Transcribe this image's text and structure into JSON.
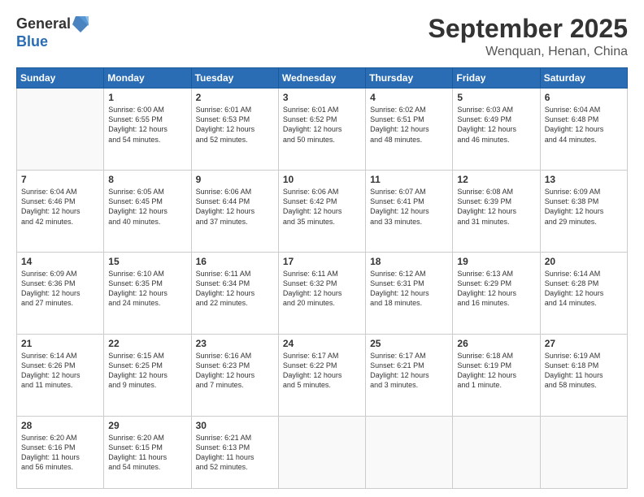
{
  "header": {
    "logo_general": "General",
    "logo_blue": "Blue",
    "title": "September 2025",
    "location": "Wenquan, Henan, China"
  },
  "days_of_week": [
    "Sunday",
    "Monday",
    "Tuesday",
    "Wednesday",
    "Thursday",
    "Friday",
    "Saturday"
  ],
  "weeks": [
    [
      {
        "day": "",
        "info": ""
      },
      {
        "day": "1",
        "info": "Sunrise: 6:00 AM\nSunset: 6:55 PM\nDaylight: 12 hours\nand 54 minutes."
      },
      {
        "day": "2",
        "info": "Sunrise: 6:01 AM\nSunset: 6:53 PM\nDaylight: 12 hours\nand 52 minutes."
      },
      {
        "day": "3",
        "info": "Sunrise: 6:01 AM\nSunset: 6:52 PM\nDaylight: 12 hours\nand 50 minutes."
      },
      {
        "day": "4",
        "info": "Sunrise: 6:02 AM\nSunset: 6:51 PM\nDaylight: 12 hours\nand 48 minutes."
      },
      {
        "day": "5",
        "info": "Sunrise: 6:03 AM\nSunset: 6:49 PM\nDaylight: 12 hours\nand 46 minutes."
      },
      {
        "day": "6",
        "info": "Sunrise: 6:04 AM\nSunset: 6:48 PM\nDaylight: 12 hours\nand 44 minutes."
      }
    ],
    [
      {
        "day": "7",
        "info": "Sunrise: 6:04 AM\nSunset: 6:46 PM\nDaylight: 12 hours\nand 42 minutes."
      },
      {
        "day": "8",
        "info": "Sunrise: 6:05 AM\nSunset: 6:45 PM\nDaylight: 12 hours\nand 40 minutes."
      },
      {
        "day": "9",
        "info": "Sunrise: 6:06 AM\nSunset: 6:44 PM\nDaylight: 12 hours\nand 37 minutes."
      },
      {
        "day": "10",
        "info": "Sunrise: 6:06 AM\nSunset: 6:42 PM\nDaylight: 12 hours\nand 35 minutes."
      },
      {
        "day": "11",
        "info": "Sunrise: 6:07 AM\nSunset: 6:41 PM\nDaylight: 12 hours\nand 33 minutes."
      },
      {
        "day": "12",
        "info": "Sunrise: 6:08 AM\nSunset: 6:39 PM\nDaylight: 12 hours\nand 31 minutes."
      },
      {
        "day": "13",
        "info": "Sunrise: 6:09 AM\nSunset: 6:38 PM\nDaylight: 12 hours\nand 29 minutes."
      }
    ],
    [
      {
        "day": "14",
        "info": "Sunrise: 6:09 AM\nSunset: 6:36 PM\nDaylight: 12 hours\nand 27 minutes."
      },
      {
        "day": "15",
        "info": "Sunrise: 6:10 AM\nSunset: 6:35 PM\nDaylight: 12 hours\nand 24 minutes."
      },
      {
        "day": "16",
        "info": "Sunrise: 6:11 AM\nSunset: 6:34 PM\nDaylight: 12 hours\nand 22 minutes."
      },
      {
        "day": "17",
        "info": "Sunrise: 6:11 AM\nSunset: 6:32 PM\nDaylight: 12 hours\nand 20 minutes."
      },
      {
        "day": "18",
        "info": "Sunrise: 6:12 AM\nSunset: 6:31 PM\nDaylight: 12 hours\nand 18 minutes."
      },
      {
        "day": "19",
        "info": "Sunrise: 6:13 AM\nSunset: 6:29 PM\nDaylight: 12 hours\nand 16 minutes."
      },
      {
        "day": "20",
        "info": "Sunrise: 6:14 AM\nSunset: 6:28 PM\nDaylight: 12 hours\nand 14 minutes."
      }
    ],
    [
      {
        "day": "21",
        "info": "Sunrise: 6:14 AM\nSunset: 6:26 PM\nDaylight: 12 hours\nand 11 minutes."
      },
      {
        "day": "22",
        "info": "Sunrise: 6:15 AM\nSunset: 6:25 PM\nDaylight: 12 hours\nand 9 minutes."
      },
      {
        "day": "23",
        "info": "Sunrise: 6:16 AM\nSunset: 6:23 PM\nDaylight: 12 hours\nand 7 minutes."
      },
      {
        "day": "24",
        "info": "Sunrise: 6:17 AM\nSunset: 6:22 PM\nDaylight: 12 hours\nand 5 minutes."
      },
      {
        "day": "25",
        "info": "Sunrise: 6:17 AM\nSunset: 6:21 PM\nDaylight: 12 hours\nand 3 minutes."
      },
      {
        "day": "26",
        "info": "Sunrise: 6:18 AM\nSunset: 6:19 PM\nDaylight: 12 hours\nand 1 minute."
      },
      {
        "day": "27",
        "info": "Sunrise: 6:19 AM\nSunset: 6:18 PM\nDaylight: 11 hours\nand 58 minutes."
      }
    ],
    [
      {
        "day": "28",
        "info": "Sunrise: 6:20 AM\nSunset: 6:16 PM\nDaylight: 11 hours\nand 56 minutes."
      },
      {
        "day": "29",
        "info": "Sunrise: 6:20 AM\nSunset: 6:15 PM\nDaylight: 11 hours\nand 54 minutes."
      },
      {
        "day": "30",
        "info": "Sunrise: 6:21 AM\nSunset: 6:13 PM\nDaylight: 11 hours\nand 52 minutes."
      },
      {
        "day": "",
        "info": ""
      },
      {
        "day": "",
        "info": ""
      },
      {
        "day": "",
        "info": ""
      },
      {
        "day": "",
        "info": ""
      }
    ]
  ]
}
